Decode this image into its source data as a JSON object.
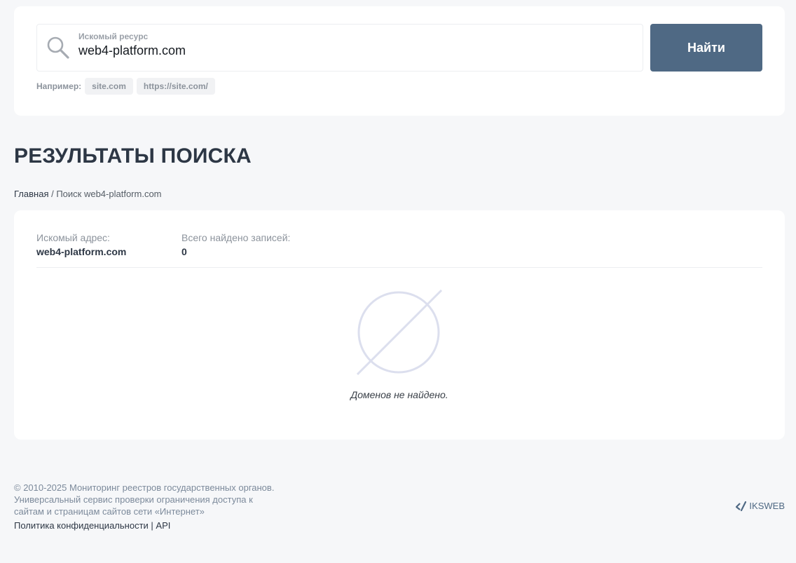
{
  "search": {
    "label": "Искомый ресурс",
    "value": "web4-platform.com",
    "button_label": "Найти",
    "examples_label": "Например:",
    "examples": [
      "site.com",
      "https://site.com/"
    ]
  },
  "page": {
    "title": "РЕЗУЛЬТАТЫ ПОИСКА",
    "breadcrumb": {
      "home": "Главная",
      "separator": " / ",
      "current": "Поиск web4-platform.com"
    }
  },
  "results": {
    "address_label": "Искомый адрес:",
    "address_value": "web4-platform.com",
    "total_label": "Всего найдено записей:",
    "total_value": "0",
    "empty_message": "Доменов не найдено."
  },
  "footer": {
    "copyright_line1": "© 2010-2025 Мониторинг реестров государственных органов.",
    "copyright_line2": "Универсальный сервис проверки ограничения доступа к",
    "copyright_line3": "сайтам и страницам сайтов сети «Интернет»",
    "privacy_link": "Политика конфиденциальности",
    "link_separator": " | ",
    "api_link": "API",
    "brand": "IKSWEB"
  },
  "colors": {
    "accent": "#4f6984",
    "background": "#f6f7f9",
    "card": "#ffffff",
    "empty_icon": "#dcdfee"
  },
  "icons": {
    "search": "search-icon",
    "empty": "empty-set-icon",
    "brand": "iksweb-logo-icon"
  }
}
